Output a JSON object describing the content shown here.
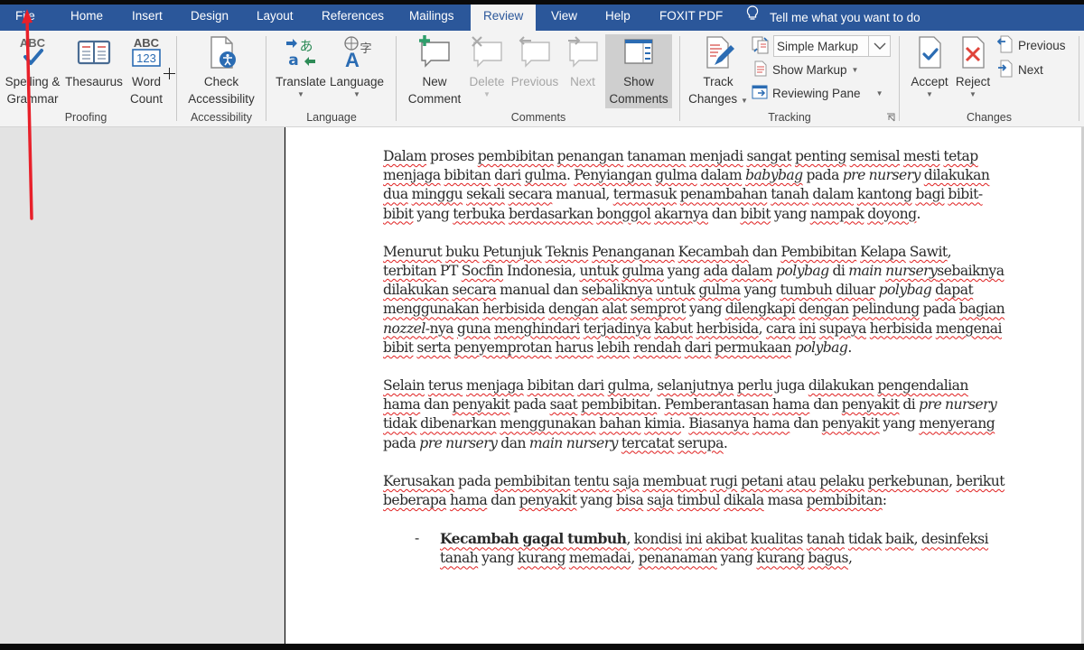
{
  "tabs": [
    {
      "label": "File"
    },
    {
      "label": "Home"
    },
    {
      "label": "Insert"
    },
    {
      "label": "Design"
    },
    {
      "label": "Layout"
    },
    {
      "label": "References"
    },
    {
      "label": "Mailings"
    },
    {
      "label": "Review",
      "active": true
    },
    {
      "label": "View"
    },
    {
      "label": "Help"
    },
    {
      "label": "FOXIT PDF"
    }
  ],
  "tell_me": {
    "icon": "lightbulb-icon",
    "placeholder": "Tell me what you want to do"
  },
  "ribbon": {
    "proofing": {
      "label": "Proofing",
      "spelling_line1": "Spelling &",
      "spelling_line2": "Grammar",
      "thesaurus": "Thesaurus",
      "wordcount_line1": "Word",
      "wordcount_line2": "Count",
      "wordcount_icon_top": "ABC",
      "wordcount_icon_bottom": "123",
      "spelling_icon_text": "ABC"
    },
    "accessibility": {
      "label": "Accessibility",
      "check_line1": "Check",
      "check_line2": "Accessibility"
    },
    "language": {
      "label": "Language",
      "translate": "Translate",
      "language": "Language"
    },
    "comments": {
      "label": "Comments",
      "new_line1": "New",
      "new_line2": "Comment",
      "delete": "Delete",
      "previous": "Previous",
      "next": "Next",
      "show_line1": "Show",
      "show_line2": "Comments"
    },
    "tracking": {
      "label": "Tracking",
      "track_line1": "Track",
      "track_line2": "Changes",
      "markup_value": "Simple Markup",
      "show_markup": "Show Markup",
      "reviewing_pane": "Reviewing Pane"
    },
    "changes": {
      "label": "Changes",
      "accept": "Accept",
      "reject": "Reject",
      "previous": "Previous",
      "next": "Next"
    }
  },
  "document": {
    "p1": [
      {
        "t": "Dalam",
        "s": 1
      },
      {
        "t": " proses "
      },
      {
        "t": "pembibitan",
        "s": 1
      },
      {
        "t": " "
      },
      {
        "t": "penangan",
        "s": 1
      },
      {
        "t": " "
      },
      {
        "t": "tanaman",
        "s": 1
      },
      {
        "t": " "
      },
      {
        "t": "menjadi",
        "s": 1
      },
      {
        "t": " "
      },
      {
        "t": "sangat",
        "s": 1
      },
      {
        "t": " "
      },
      {
        "t": "penting",
        "s": 1
      },
      {
        "t": " "
      },
      {
        "t": "semisal",
        "s": 1
      },
      {
        "t": " "
      },
      {
        "t": "mesti",
        "s": 1
      },
      {
        "t": " "
      },
      {
        "t": "tetap",
        "s": 1
      },
      {
        "t": " "
      },
      {
        "t": "menjaga",
        "s": 1
      },
      {
        "t": " "
      },
      {
        "t": "bibitan",
        "s": 1
      },
      {
        "t": " "
      },
      {
        "t": "dari",
        "s": 1
      },
      {
        "t": " "
      },
      {
        "t": "gulma",
        "s": 1
      },
      {
        "t": ". "
      },
      {
        "t": "Penyiangan",
        "s": 1
      },
      {
        "t": " "
      },
      {
        "t": "gulma",
        "s": 1
      },
      {
        "t": " "
      },
      {
        "t": "dalam",
        "s": 1
      },
      {
        "t": " "
      },
      {
        "t": "babybag",
        "s": 1,
        "i": 1
      },
      {
        "t": " pada "
      },
      {
        "t": "pre",
        "i": 1
      },
      {
        "t": " "
      },
      {
        "t": "nursery",
        "i": 1
      },
      {
        "t": " "
      },
      {
        "t": "dilakukan",
        "s": 1
      },
      {
        "t": " "
      },
      {
        "t": "dua",
        "s": 1
      },
      {
        "t": " "
      },
      {
        "t": "minggu",
        "s": 1
      },
      {
        "t": " "
      },
      {
        "t": "sekali",
        "s": 1
      },
      {
        "t": " "
      },
      {
        "t": "secara",
        "s": 1
      },
      {
        "t": " manual, "
      },
      {
        "t": "termasuk",
        "s": 1
      },
      {
        "t": " "
      },
      {
        "t": "penambahan",
        "s": 1
      },
      {
        "t": " "
      },
      {
        "t": "tanah",
        "s": 1
      },
      {
        "t": " "
      },
      {
        "t": "dalam",
        "s": 1
      },
      {
        "t": " "
      },
      {
        "t": "kantong",
        "s": 1
      },
      {
        "t": " "
      },
      {
        "t": "bagi",
        "s": 1
      },
      {
        "t": " "
      },
      {
        "t": "bibit-bibit",
        "s": 1
      },
      {
        "t": " yang "
      },
      {
        "t": "terbuka",
        "s": 1
      },
      {
        "t": " "
      },
      {
        "t": "berdasarkan",
        "s": 1
      },
      {
        "t": " "
      },
      {
        "t": "bonggol",
        "s": 1
      },
      {
        "t": " "
      },
      {
        "t": "akarnya",
        "s": 1
      },
      {
        "t": " dan "
      },
      {
        "t": "bibit",
        "s": 1
      },
      {
        "t": " "
      },
      {
        "t": "yang "
      },
      {
        "t": "nampak",
        "s": 1
      },
      {
        "t": " "
      },
      {
        "t": "doyong",
        "s": 1
      },
      {
        "t": "."
      }
    ],
    "p2": [
      {
        "t": "Menurut",
        "s": 1
      },
      {
        "t": " "
      },
      {
        "t": "buku",
        "s": 1
      },
      {
        "t": " "
      },
      {
        "t": "Petunjuk",
        "s": 1
      },
      {
        "t": " "
      },
      {
        "t": "Teknis",
        "s": 1
      },
      {
        "t": " "
      },
      {
        "t": "Penanganan",
        "s": 1
      },
      {
        "t": " "
      },
      {
        "t": "Kecambah",
        "s": 1
      },
      {
        "t": " dan "
      },
      {
        "t": "Pembibitan",
        "s": 1
      },
      {
        "t": " "
      },
      {
        "t": "Kelapa",
        "s": 1
      },
      {
        "t": " "
      },
      {
        "t": "Sawit",
        "s": 1
      },
      {
        "t": ", "
      },
      {
        "t": "terbitan",
        "s": 1
      },
      {
        "t": " PT "
      },
      {
        "t": "Socfin",
        "s": 1
      },
      {
        "t": " Indonesia, "
      },
      {
        "t": "untuk",
        "s": 1
      },
      {
        "t": " "
      },
      {
        "t": "gulma",
        "s": 1
      },
      {
        "t": " yang "
      },
      {
        "t": "ada",
        "s": 1
      },
      {
        "t": " "
      },
      {
        "t": "dalam",
        "s": 1
      },
      {
        "t": " "
      },
      {
        "t": "polybag",
        "i": 1
      },
      {
        "t": " di "
      },
      {
        "t": "main",
        "i": 1
      },
      {
        "t": " "
      },
      {
        "t": "nurserysebaiknya",
        "s": 1,
        "i_prefix": "nursery"
      },
      {
        "t": " "
      },
      {
        "t": "dilakukan",
        "s": 1
      },
      {
        "t": " "
      },
      {
        "t": "secara",
        "s": 1
      },
      {
        "t": " manual dan "
      },
      {
        "t": "sebaliknya",
        "s": 1
      },
      {
        "t": " "
      },
      {
        "t": "untuk",
        "s": 1
      },
      {
        "t": " "
      },
      {
        "t": "gulma",
        "s": 1
      },
      {
        "t": " yang "
      },
      {
        "t": "tumbuh",
        "s": 1
      },
      {
        "t": " "
      },
      {
        "t": "diluar",
        "s": 1
      },
      {
        "t": " "
      },
      {
        "t": "polybag",
        "i": 1
      },
      {
        "t": " "
      },
      {
        "t": "dapat",
        "s": 1
      },
      {
        "t": " "
      },
      {
        "t": "menggunakan",
        "s": 1
      },
      {
        "t": " "
      },
      {
        "t": "herbisida",
        "s": 1
      },
      {
        "t": " "
      },
      {
        "t": "dengan",
        "s": 1
      },
      {
        "t": " "
      },
      {
        "t": "alat",
        "s": 1
      },
      {
        "t": " "
      },
      {
        "t": "semprot",
        "s": 1
      },
      {
        "t": " yang "
      },
      {
        "t": "dilengkapi",
        "s": 1
      },
      {
        "t": " "
      },
      {
        "t": "dengan",
        "s": 1
      },
      {
        "t": " "
      },
      {
        "t": "pelindung",
        "s": 1
      },
      {
        "t": " pada "
      },
      {
        "t": "bagian",
        "s": 1
      },
      {
        "t": " "
      },
      {
        "t": "nozzel",
        "s": 1,
        "i": 1
      },
      {
        "t": "-nya",
        "s": 1
      },
      {
        "t": " "
      },
      {
        "t": "guna",
        "s": 1
      },
      {
        "t": " "
      },
      {
        "t": "menghindari",
        "s": 1
      },
      {
        "t": " "
      },
      {
        "t": "terjadinya",
        "s": 1
      },
      {
        "t": " "
      },
      {
        "t": "kabut",
        "s": 1
      },
      {
        "t": " "
      },
      {
        "t": "herbisida",
        "s": 1
      },
      {
        "t": ", "
      },
      {
        "t": "cara",
        "s": 1
      },
      {
        "t": " "
      },
      {
        "t": "ini",
        "s": 1
      },
      {
        "t": " "
      },
      {
        "t": "supaya",
        "s": 1
      },
      {
        "t": " "
      },
      {
        "t": "herbisida",
        "s": 1
      },
      {
        "t": " "
      },
      {
        "t": "mengenai",
        "s": 1
      },
      {
        "t": " "
      },
      {
        "t": "bibit",
        "s": 1
      },
      {
        "t": " "
      },
      {
        "t": "serta",
        "s": 1
      },
      {
        "t": " "
      },
      {
        "t": "penyemprotan",
        "s": 1
      },
      {
        "t": " "
      },
      {
        "t": "harus",
        "s": 1
      },
      {
        "t": " "
      },
      {
        "t": "lebih",
        "s": 1
      },
      {
        "t": " "
      },
      {
        "t": "rendah",
        "s": 1
      },
      {
        "t": " "
      },
      {
        "t": "dari",
        "s": 1
      },
      {
        "t": " "
      },
      {
        "t": "permukaan",
        "s": 1
      },
      {
        "t": " "
      },
      {
        "t": "polybag",
        "i": 1
      },
      {
        "t": "."
      }
    ],
    "p3": [
      {
        "t": "Selain",
        "s": 1
      },
      {
        "t": " "
      },
      {
        "t": "terus",
        "s": 1
      },
      {
        "t": " "
      },
      {
        "t": "menjaga",
        "s": 1
      },
      {
        "t": " "
      },
      {
        "t": "bibitan",
        "s": 1
      },
      {
        "t": " "
      },
      {
        "t": "dari",
        "s": 1
      },
      {
        "t": " "
      },
      {
        "t": "gulma",
        "s": 1
      },
      {
        "t": ", "
      },
      {
        "t": "selanjutnya",
        "s": 1
      },
      {
        "t": " "
      },
      {
        "t": "perlu",
        "s": 1
      },
      {
        "t": " juga "
      },
      {
        "t": "dilakukan",
        "s": 1
      },
      {
        "t": " "
      },
      {
        "t": "pengendalian",
        "s": 1
      },
      {
        "t": " "
      },
      {
        "t": "hama",
        "s": 1
      },
      {
        "t": " dan "
      },
      {
        "t": "penyakit",
        "s": 1
      },
      {
        "t": " pada "
      },
      {
        "t": "saat",
        "s": 1
      },
      {
        "t": " "
      },
      {
        "t": "pembibitan",
        "s": 1
      },
      {
        "t": ". "
      },
      {
        "t": "Pemberantasan",
        "s": 1
      },
      {
        "t": " "
      },
      {
        "t": "hama",
        "s": 1
      },
      {
        "t": " dan "
      },
      {
        "t": "penyakit",
        "s": 1
      },
      {
        "t": " di "
      },
      {
        "t": "pre nursery",
        "i": 1
      },
      {
        "t": " "
      },
      {
        "t": "tidak",
        "s": 1
      },
      {
        "t": " "
      },
      {
        "t": "dibenarkan",
        "s": 1
      },
      {
        "t": " "
      },
      {
        "t": "menggunakan",
        "s": 1
      },
      {
        "t": " "
      },
      {
        "t": "bahan",
        "s": 1
      },
      {
        "t": " "
      },
      {
        "t": "kimia",
        "s": 1
      },
      {
        "t": ". "
      },
      {
        "t": "Biasanya",
        "s": 1
      },
      {
        "t": " "
      },
      {
        "t": "hama",
        "s": 1
      },
      {
        "t": " dan "
      },
      {
        "t": "penyakit",
        "s": 1
      },
      {
        "t": " yang "
      },
      {
        "t": "menyerang",
        "s": 1
      },
      {
        "t": " pada "
      },
      {
        "t": "pre nursery",
        "i": 1
      },
      {
        "t": " dan "
      },
      {
        "t": "main nursery",
        "i": 1
      },
      {
        "t": " "
      },
      {
        "t": "tercatat",
        "s": 1
      },
      {
        "t": " "
      },
      {
        "t": "serupa",
        "s": 1
      },
      {
        "t": "."
      }
    ],
    "p4": [
      {
        "t": "Kerusakan",
        "s": 1
      },
      {
        "t": " pada "
      },
      {
        "t": "pembibitan",
        "s": 1
      },
      {
        "t": " "
      },
      {
        "t": "tentu",
        "s": 1
      },
      {
        "t": " "
      },
      {
        "t": "saja",
        "s": 1
      },
      {
        "t": " "
      },
      {
        "t": "membuat",
        "s": 1
      },
      {
        "t": " "
      },
      {
        "t": "rugi",
        "s": 1
      },
      {
        "t": " "
      },
      {
        "t": "petani",
        "s": 1
      },
      {
        "t": " "
      },
      {
        "t": "atau",
        "s": 1
      },
      {
        "t": " "
      },
      {
        "t": "pelaku",
        "s": 1
      },
      {
        "t": " "
      },
      {
        "t": "perkebunan",
        "s": 1
      },
      {
        "t": ", "
      },
      {
        "t": "berikut",
        "s": 1
      },
      {
        "t": " "
      },
      {
        "t": "beberapa",
        "s": 1
      },
      {
        "t": " "
      },
      {
        "t": "hama",
        "s": 1
      },
      {
        "t": " dan "
      },
      {
        "t": "penyakit",
        "s": 1
      },
      {
        "t": " yang "
      },
      {
        "t": "bisa",
        "s": 1
      },
      {
        "t": " "
      },
      {
        "t": "saja",
        "s": 1
      },
      {
        "t": " "
      },
      {
        "t": "timbul",
        "s": 1
      },
      {
        "t": " "
      },
      {
        "t": "dikala",
        "s": 1
      },
      {
        "t": " masa "
      },
      {
        "t": "pembibitan",
        "s": 1
      },
      {
        "t": ":"
      }
    ],
    "bullet1": {
      "dash": "-",
      "runs": [
        {
          "t": "Kecambah gagal tumbuh",
          "s": 1,
          "b": 1
        },
        {
          "t": ", "
        },
        {
          "t": "kondisi",
          "s": 1
        },
        {
          "t": " "
        },
        {
          "t": "ini",
          "s": 1
        },
        {
          "t": " "
        },
        {
          "t": "akibat",
          "s": 1
        },
        {
          "t": " "
        },
        {
          "t": "kualitas",
          "s": 1
        },
        {
          "t": " "
        },
        {
          "t": "tanah",
          "s": 1
        },
        {
          "t": " "
        },
        {
          "t": "tidak",
          "s": 1
        },
        {
          "t": " "
        },
        {
          "t": "baik",
          "s": 1
        },
        {
          "t": ", "
        },
        {
          "t": "desinfeksi",
          "s": 1
        },
        {
          "t": " "
        },
        {
          "t": "tanah",
          "s": 1
        },
        {
          "t": " yang "
        },
        {
          "t": "kurang",
          "s": 1
        },
        {
          "t": " "
        },
        {
          "t": "memadai",
          "s": 1
        },
        {
          "t": ", "
        },
        {
          "t": "penanaman",
          "s": 1
        },
        {
          "t": " yang "
        },
        {
          "t": "kurang",
          "s": 1
        },
        {
          "t": " "
        },
        {
          "t": "bagus",
          "s": 1
        },
        {
          "t": ","
        }
      ]
    }
  },
  "colors": {
    "ribbon_tab_bar": "#2b579a",
    "ribbon_bg": "#f3f3f3",
    "spell_underline": "#e02020",
    "annotation_red": "#e8202a"
  }
}
